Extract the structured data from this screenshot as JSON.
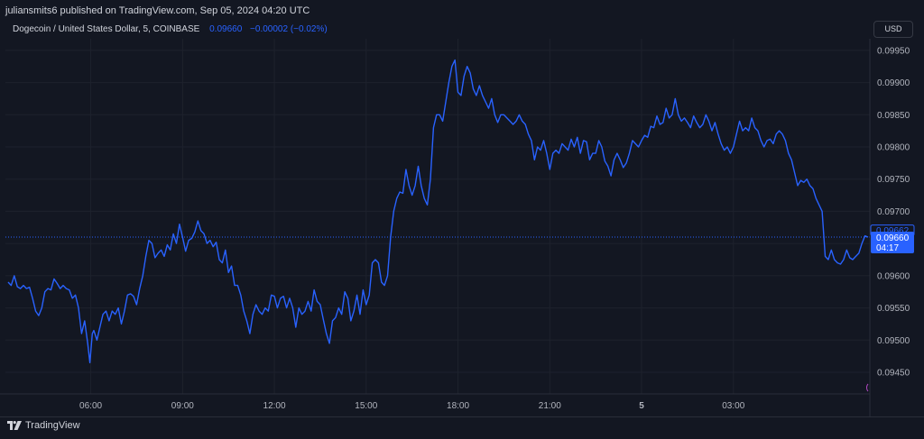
{
  "header": {
    "publisher_line": "juliansmits6 published on TradingView.com, Sep 05, 2024 04:20 UTC"
  },
  "symbol": {
    "name": "Dogecoin / United States Dollar, 5, COINBASE",
    "last": "0.09660",
    "change": "−0.00002 (−0.02%)"
  },
  "currency_label": "USD",
  "price_tags": {
    "upper": "0.09662",
    "last": "0.09660",
    "countdown": "04:17"
  },
  "footer": {
    "brand": "TradingView"
  },
  "colors": {
    "background": "#131722",
    "line": "#2962ff",
    "grid": "#1e222d",
    "text": "#d1d4dc"
  },
  "chart_data": {
    "type": "line",
    "title": "Dogecoin / United States Dollar, 5, COINBASE",
    "xlabel": "",
    "ylabel": "",
    "ylim": [
      0.09422,
      0.09968
    ],
    "y_ticks": [
      "0.09950",
      "0.09900",
      "0.09850",
      "0.09800",
      "0.09750",
      "0.09700",
      "0.09650",
      "0.09600",
      "0.09550",
      "0.09500",
      "0.09450"
    ],
    "x_ticks": [
      {
        "label": "06:00",
        "t": 6.0,
        "bold": false
      },
      {
        "label": "09:00",
        "t": 9.0,
        "bold": false
      },
      {
        "label": "12:00",
        "t": 12.0,
        "bold": false
      },
      {
        "label": "15:00",
        "t": 15.0,
        "bold": false
      },
      {
        "label": "18:00",
        "t": 18.0,
        "bold": false
      },
      {
        "label": "21:00",
        "t": 21.0,
        "bold": false
      },
      {
        "label": "5",
        "t": 24.0,
        "bold": true
      },
      {
        "label": "03:00",
        "t": 27.0,
        "bold": false
      }
    ],
    "grid": true,
    "last_price_line": 0.0966,
    "series": [
      {
        "values": [
          [
            3.3,
            0.0959
          ],
          [
            3.4,
            0.09585
          ],
          [
            3.5,
            0.096
          ],
          [
            3.6,
            0.09583
          ],
          [
            3.7,
            0.0958
          ],
          [
            3.8,
            0.09585
          ],
          [
            3.9,
            0.0958
          ],
          [
            4.0,
            0.09582
          ],
          [
            4.1,
            0.09565
          ],
          [
            4.2,
            0.09545
          ],
          [
            4.3,
            0.09538
          ],
          [
            4.4,
            0.0955
          ],
          [
            4.5,
            0.09575
          ],
          [
            4.6,
            0.0958
          ],
          [
            4.7,
            0.09578
          ],
          [
            4.8,
            0.09595
          ],
          [
            4.9,
            0.09588
          ],
          [
            5.0,
            0.0958
          ],
          [
            5.1,
            0.09585
          ],
          [
            5.2,
            0.0958
          ],
          [
            5.3,
            0.09578
          ],
          [
            5.4,
            0.09565
          ],
          [
            5.5,
            0.0957
          ],
          [
            5.6,
            0.0955
          ],
          [
            5.7,
            0.0951
          ],
          [
            5.8,
            0.0953
          ],
          [
            5.9,
            0.09495
          ],
          [
            5.97,
            0.09465
          ],
          [
            6.05,
            0.0951
          ],
          [
            6.1,
            0.09515
          ],
          [
            6.2,
            0.095
          ],
          [
            6.3,
            0.0952
          ],
          [
            6.4,
            0.0954
          ],
          [
            6.5,
            0.09545
          ],
          [
            6.6,
            0.0953
          ],
          [
            6.7,
            0.09545
          ],
          [
            6.8,
            0.0954
          ],
          [
            6.9,
            0.0955
          ],
          [
            7.0,
            0.09525
          ],
          [
            7.1,
            0.09545
          ],
          [
            7.2,
            0.0957
          ],
          [
            7.3,
            0.09572
          ],
          [
            7.4,
            0.09568
          ],
          [
            7.5,
            0.09555
          ],
          [
            7.6,
            0.0958
          ],
          [
            7.7,
            0.096
          ],
          [
            7.8,
            0.0963
          ],
          [
            7.9,
            0.09655
          ],
          [
            8.0,
            0.0965
          ],
          [
            8.1,
            0.09628
          ],
          [
            8.2,
            0.09635
          ],
          [
            8.3,
            0.0964
          ],
          [
            8.4,
            0.0963
          ],
          [
            8.5,
            0.09648
          ],
          [
            8.6,
            0.0964
          ],
          [
            8.7,
            0.09665
          ],
          [
            8.8,
            0.0965
          ],
          [
            8.9,
            0.0968
          ],
          [
            9.0,
            0.0966
          ],
          [
            9.1,
            0.09638
          ],
          [
            9.2,
            0.09655
          ],
          [
            9.3,
            0.09658
          ],
          [
            9.4,
            0.09668
          ],
          [
            9.5,
            0.09685
          ],
          [
            9.6,
            0.0967
          ],
          [
            9.7,
            0.09665
          ],
          [
            9.8,
            0.0965
          ],
          [
            9.9,
            0.09655
          ],
          [
            10.0,
            0.09645
          ],
          [
            10.1,
            0.09652
          ],
          [
            10.2,
            0.09625
          ],
          [
            10.3,
            0.0962
          ],
          [
            10.4,
            0.0964
          ],
          [
            10.5,
            0.09605
          ],
          [
            10.6,
            0.09615
          ],
          [
            10.7,
            0.09585
          ],
          [
            10.8,
            0.09585
          ],
          [
            10.9,
            0.0957
          ],
          [
            11.0,
            0.09545
          ],
          [
            11.1,
            0.0953
          ],
          [
            11.2,
            0.0951
          ],
          [
            11.3,
            0.0954
          ],
          [
            11.4,
            0.09555
          ],
          [
            11.5,
            0.09545
          ],
          [
            11.6,
            0.0954
          ],
          [
            11.7,
            0.0955
          ],
          [
            11.8,
            0.09545
          ],
          [
            11.9,
            0.0957
          ],
          [
            12.0,
            0.09568
          ],
          [
            12.1,
            0.0955
          ],
          [
            12.2,
            0.09565
          ],
          [
            12.3,
            0.09568
          ],
          [
            12.4,
            0.0955
          ],
          [
            12.5,
            0.09565
          ],
          [
            12.6,
            0.0955
          ],
          [
            12.7,
            0.0952
          ],
          [
            12.8,
            0.0955
          ],
          [
            12.9,
            0.0954
          ],
          [
            13.0,
            0.09545
          ],
          [
            13.1,
            0.0956
          ],
          [
            13.2,
            0.09545
          ],
          [
            13.3,
            0.09578
          ],
          [
            13.4,
            0.0956
          ],
          [
            13.5,
            0.09555
          ],
          [
            13.6,
            0.09532
          ],
          [
            13.7,
            0.0951
          ],
          [
            13.8,
            0.09495
          ],
          [
            13.9,
            0.0953
          ],
          [
            14.0,
            0.09535
          ],
          [
            14.1,
            0.0955
          ],
          [
            14.2,
            0.0954
          ],
          [
            14.3,
            0.09575
          ],
          [
            14.4,
            0.09565
          ],
          [
            14.5,
            0.0953
          ],
          [
            14.6,
            0.09545
          ],
          [
            14.7,
            0.0957
          ],
          [
            14.8,
            0.0954
          ],
          [
            14.9,
            0.09578
          ],
          [
            15.0,
            0.09555
          ],
          [
            15.1,
            0.0957
          ],
          [
            15.2,
            0.0962
          ],
          [
            15.3,
            0.09625
          ],
          [
            15.4,
            0.0962
          ],
          [
            15.5,
            0.0959
          ],
          [
            15.6,
            0.09585
          ],
          [
            15.7,
            0.096
          ],
          [
            15.8,
            0.0966
          ],
          [
            15.9,
            0.097
          ],
          [
            16.0,
            0.0972
          ],
          [
            16.1,
            0.0973
          ],
          [
            16.2,
            0.09728
          ],
          [
            16.3,
            0.09765
          ],
          [
            16.4,
            0.0974
          ],
          [
            16.5,
            0.09725
          ],
          [
            16.6,
            0.0974
          ],
          [
            16.7,
            0.0977
          ],
          [
            16.8,
            0.0974
          ],
          [
            16.9,
            0.0972
          ],
          [
            17.0,
            0.0971
          ],
          [
            17.1,
            0.0975
          ],
          [
            17.2,
            0.0983
          ],
          [
            17.3,
            0.0985
          ],
          [
            17.4,
            0.0985
          ],
          [
            17.5,
            0.0984
          ],
          [
            17.6,
            0.0987
          ],
          [
            17.7,
            0.099
          ],
          [
            17.8,
            0.09925
          ],
          [
            17.9,
            0.09935
          ],
          [
            18.0,
            0.09885
          ],
          [
            18.1,
            0.0988
          ],
          [
            18.2,
            0.0991
          ],
          [
            18.3,
            0.09925
          ],
          [
            18.4,
            0.09915
          ],
          [
            18.5,
            0.0989
          ],
          [
            18.6,
            0.0988
          ],
          [
            18.7,
            0.09895
          ],
          [
            18.8,
            0.0988
          ],
          [
            18.9,
            0.0987
          ],
          [
            19.0,
            0.0986
          ],
          [
            19.1,
            0.09875
          ],
          [
            19.2,
            0.0985
          ],
          [
            19.3,
            0.09838
          ],
          [
            19.4,
            0.0985
          ],
          [
            19.5,
            0.0985
          ],
          [
            19.6,
            0.09845
          ],
          [
            19.7,
            0.0984
          ],
          [
            19.8,
            0.09835
          ],
          [
            19.9,
            0.0984
          ],
          [
            20.0,
            0.0985
          ],
          [
            20.1,
            0.0984
          ],
          [
            20.2,
            0.09835
          ],
          [
            20.3,
            0.0982
          ],
          [
            20.4,
            0.0981
          ],
          [
            20.5,
            0.0978
          ],
          [
            20.6,
            0.098
          ],
          [
            20.7,
            0.09795
          ],
          [
            20.8,
            0.0981
          ],
          [
            20.9,
            0.0979
          ],
          [
            21.0,
            0.09765
          ],
          [
            21.1,
            0.0979
          ],
          [
            21.2,
            0.09795
          ],
          [
            21.3,
            0.0979
          ],
          [
            21.4,
            0.09805
          ],
          [
            21.5,
            0.098
          ],
          [
            21.6,
            0.09795
          ],
          [
            21.7,
            0.09812
          ],
          [
            21.8,
            0.098
          ],
          [
            21.9,
            0.09815
          ],
          [
            22.0,
            0.0979
          ],
          [
            22.1,
            0.0981
          ],
          [
            22.2,
            0.09808
          ],
          [
            22.3,
            0.0978
          ],
          [
            22.4,
            0.0979
          ],
          [
            22.5,
            0.0979
          ],
          [
            22.6,
            0.0981
          ],
          [
            22.7,
            0.098
          ],
          [
            22.8,
            0.09778
          ],
          [
            22.9,
            0.0977
          ],
          [
            23.0,
            0.09755
          ],
          [
            23.1,
            0.0978
          ],
          [
            23.2,
            0.0979
          ],
          [
            23.3,
            0.0978
          ],
          [
            23.4,
            0.09768
          ],
          [
            23.5,
            0.09775
          ],
          [
            23.6,
            0.0979
          ],
          [
            23.7,
            0.0981
          ],
          [
            23.8,
            0.09805
          ],
          [
            23.9,
            0.098
          ],
          [
            24.0,
            0.0981
          ],
          [
            24.1,
            0.09818
          ],
          [
            24.2,
            0.09815
          ],
          [
            24.3,
            0.09832
          ],
          [
            24.4,
            0.0983
          ],
          [
            24.5,
            0.09848
          ],
          [
            24.6,
            0.09835
          ],
          [
            24.7,
            0.09838
          ],
          [
            24.8,
            0.0986
          ],
          [
            24.9,
            0.09845
          ],
          [
            25.0,
            0.0985
          ],
          [
            25.1,
            0.09875
          ],
          [
            25.2,
            0.0985
          ],
          [
            25.3,
            0.0984
          ],
          [
            25.4,
            0.09845
          ],
          [
            25.5,
            0.09838
          ],
          [
            25.6,
            0.0983
          ],
          [
            25.7,
            0.09848
          ],
          [
            25.8,
            0.09838
          ],
          [
            25.9,
            0.0983
          ],
          [
            26.0,
            0.09835
          ],
          [
            26.1,
            0.0985
          ],
          [
            26.2,
            0.0984
          ],
          [
            26.3,
            0.09825
          ],
          [
            26.4,
            0.09838
          ],
          [
            26.5,
            0.0982
          ],
          [
            26.6,
            0.09805
          ],
          [
            26.7,
            0.09795
          ],
          [
            26.8,
            0.098
          ],
          [
            26.9,
            0.0979
          ],
          [
            27.0,
            0.098
          ],
          [
            27.1,
            0.0982
          ],
          [
            27.2,
            0.0984
          ],
          [
            27.3,
            0.09825
          ],
          [
            27.4,
            0.0983
          ],
          [
            27.5,
            0.09825
          ],
          [
            27.6,
            0.09845
          ],
          [
            27.7,
            0.0983
          ],
          [
            27.8,
            0.09825
          ],
          [
            27.9,
            0.0981
          ],
          [
            28.0,
            0.098
          ],
          [
            28.1,
            0.0981
          ],
          [
            28.2,
            0.09812
          ],
          [
            28.3,
            0.09805
          ],
          [
            28.4,
            0.0982
          ],
          [
            28.5,
            0.09825
          ],
          [
            28.6,
            0.0982
          ],
          [
            28.7,
            0.0981
          ],
          [
            28.8,
            0.0979
          ],
          [
            28.9,
            0.0978
          ],
          [
            29.0,
            0.0976
          ],
          [
            29.1,
            0.0974
          ],
          [
            29.2,
            0.09748
          ],
          [
            29.3,
            0.09745
          ],
          [
            29.4,
            0.0975
          ],
          [
            29.5,
            0.0974
          ],
          [
            29.6,
            0.09735
          ],
          [
            29.7,
            0.0972
          ],
          [
            29.8,
            0.0971
          ],
          [
            29.9,
            0.097
          ],
          [
            30.0,
            0.0963
          ],
          [
            30.1,
            0.09625
          ],
          [
            30.2,
            0.0964
          ],
          [
            30.3,
            0.09625
          ],
          [
            30.4,
            0.0962
          ],
          [
            30.5,
            0.09618
          ],
          [
            30.6,
            0.09625
          ],
          [
            30.7,
            0.0964
          ],
          [
            30.8,
            0.09628
          ],
          [
            30.9,
            0.09625
          ],
          [
            31.0,
            0.0963
          ],
          [
            31.1,
            0.09635
          ],
          [
            31.2,
            0.0965
          ],
          [
            31.3,
            0.09662
          ],
          [
            31.4,
            0.0966
          ]
        ]
      }
    ]
  }
}
